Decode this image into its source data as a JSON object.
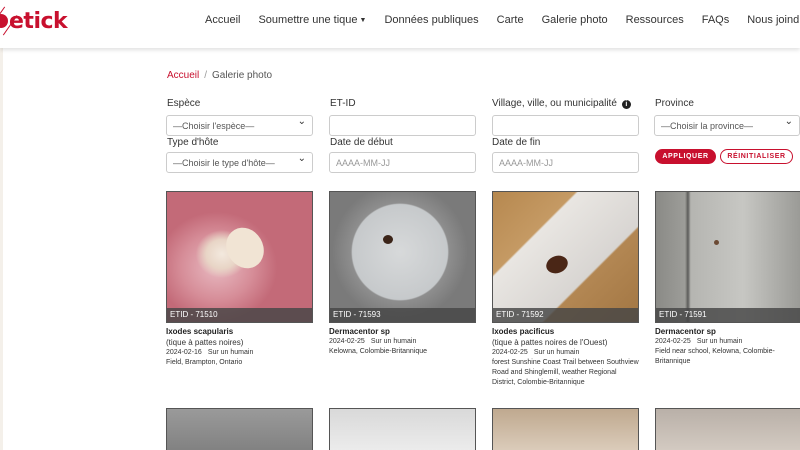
{
  "logo": "etick",
  "nav": [
    {
      "label": "Accueil"
    },
    {
      "label": "Soumettre une tique",
      "has_caret": true
    },
    {
      "label": "Données publiques"
    },
    {
      "label": "Carte"
    },
    {
      "label": "Galerie photo"
    },
    {
      "label": "Ressources"
    },
    {
      "label": "FAQs"
    },
    {
      "label": "Nous joindre"
    }
  ],
  "breadcrumb": {
    "home": "Accueil",
    "separator": "/",
    "current": "Galerie photo"
  },
  "filters": {
    "species": {
      "label": "Espèce",
      "value": "—Choisir l'espèce—"
    },
    "etid": {
      "label": "ET-ID",
      "value": ""
    },
    "village": {
      "label": "Village, ville, ou municipalité",
      "value": ""
    },
    "province": {
      "label": "Province",
      "value": "—Choisir la province—"
    },
    "host_type": {
      "label": "Type d'hôte",
      "value": "—Choisir le type d'hôte—"
    },
    "start_date": {
      "label": "Date de début",
      "placeholder": "AAAA-MM-JJ"
    },
    "end_date": {
      "label": "Date de fin",
      "placeholder": "AAAA-MM-JJ"
    },
    "apply": "APPLIQUER",
    "reset": "RÉINITIALISER"
  },
  "cards": [
    {
      "etid": "ETID - 71510",
      "species": "Ixodes scapularis",
      "common": "(tique à pattes noires)",
      "date": "2024-02-16",
      "host": "Sur un humain",
      "location": "Field, Brampton, Ontario"
    },
    {
      "etid": "ETID - 71593",
      "species": "Dermacentor sp",
      "common": "",
      "date": "2024-02-25",
      "host": "Sur un humain",
      "location": "Kelowna, Colombie-Britannique"
    },
    {
      "etid": "ETID - 71592",
      "species": "Ixodes pacificus",
      "common": "(tique à pattes noires de l'Ouest)",
      "date": "2024-02-25",
      "host": "Sur un humain",
      "location": "forest Sunshine Coast Trail between Southview Road and Shinglemill, weather Regional District, Colombie-Britannique"
    },
    {
      "etid": "ETID - 71591",
      "species": "Dermacentor sp",
      "common": "",
      "date": "2024-02-25",
      "host": "Sur un humain",
      "location": "Field near school, Kelowna, Colombie-Britannique"
    }
  ],
  "colors": {
    "brand": "#c8102e"
  }
}
